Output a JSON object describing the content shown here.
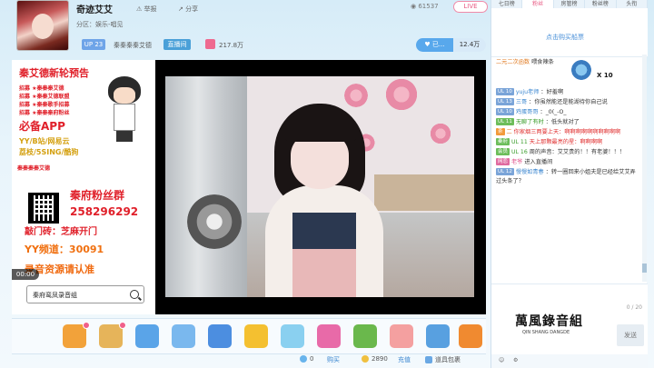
{
  "header": {
    "anchor_name": "奇迹艾艾",
    "report": "举报",
    "share": "分享",
    "category": "分区：娱乐-唱见",
    "views": "61537",
    "like": "LIVE",
    "level": "UP 23",
    "fan_club": "秦秦秦秦艾德",
    "fan_badge": "直播间",
    "fans_count": "217.8万",
    "follow_label": "已...",
    "follow_count": "12.4万"
  },
  "promo": {
    "title": "秦艾德新轮预告",
    "items": [
      "招募 ★秦秦秦艾德",
      "招募 ★秦秦艾德联盟",
      "招募 ★秦秦歌手招募",
      "招募 ★秦秦秦府粉丝"
    ],
    "app": "必备APP",
    "platforms": "YY/B站/网易云",
    "platforms2": "荔枝/5SING/酷狗",
    "side_label": "秦秦秦秦艾德",
    "fans_group": "秦府粉丝群",
    "group_no": "258296292",
    "motto": "敲门砖：芝麻开门",
    "yy_channel": "YY频道：30091",
    "resource": "录音资源请认准",
    "search_text": "秦府鸾凤录音组"
  },
  "video": {
    "time": "00:00"
  },
  "footer": {
    "count_a": "0",
    "label_a": "购买",
    "count_b": "2890",
    "label_b": "充值",
    "props": "道具包裹"
  },
  "panel": {
    "tabs": [
      "七日榜",
      "粉丝",
      "房管榜",
      "粉丝榜",
      "头衔"
    ],
    "active_tab": 1,
    "rank_link": "点击购买船票",
    "chat": [
      {
        "lv": "",
        "lvclass": "",
        "user": "二元二次函数",
        "uclass": "orange",
        "text": "喂食辣条",
        "red": false,
        "gift": true,
        "count": "X 10"
      },
      {
        "lv": "UL 10",
        "lvclass": "",
        "user": "yuju老师",
        "uclass": "",
        "text": "：好羞啊",
        "red": false
      },
      {
        "lv": "UL 13",
        "lvclass": "",
        "user": "三哥",
        "uclass": "",
        "text": "：你虽然能还是能湖待你自己说",
        "red": false
      },
      {
        "lv": "UL 10",
        "lvclass": "",
        "user": "鸡蛋哥哥",
        "uclass": "",
        "text": "：_0(_-O_",
        "red": false
      },
      {
        "lv": "UL 11",
        "lvclass": "g",
        "user": "无聊了有时",
        "uclass": "green",
        "text": "：低头就对了",
        "red": false
      },
      {
        "lv": "茶",
        "lvclass": "o",
        "user": "二",
        "uclass": "orange",
        "text": "你家烟三两要上天：啊啊啊啊啊啊啊啊啊啊",
        "red": true
      },
      {
        "lv": "秦府",
        "lvclass": "g",
        "user": "UL 11",
        "uclass": "green",
        "text": "天上那颗最亮的星：啊啊啊啊",
        "red": true
      },
      {
        "lv": "会员",
        "lvclass": "g",
        "user": "UL 16",
        "uclass": "green",
        "text": "周的声音：艾艾贵的！！有老婆！！！",
        "red": false
      },
      {
        "lv": "网恋",
        "lvclass": "p",
        "user": "老爷",
        "uclass": "pink",
        "text": "进入直播间",
        "red": false
      },
      {
        "lv": "UL 12",
        "lvclass": "",
        "user": "慢慢如青春",
        "uclass": "",
        "text": "：转一圈回来小姐夫是已经给艾艾弄过头条了？",
        "red": false
      }
    ],
    "calligraphy": "萬風錄音組",
    "calligraphy_sub": "QIN SHANG DANGDE",
    "counter": "0 / 20",
    "send": "发送"
  }
}
